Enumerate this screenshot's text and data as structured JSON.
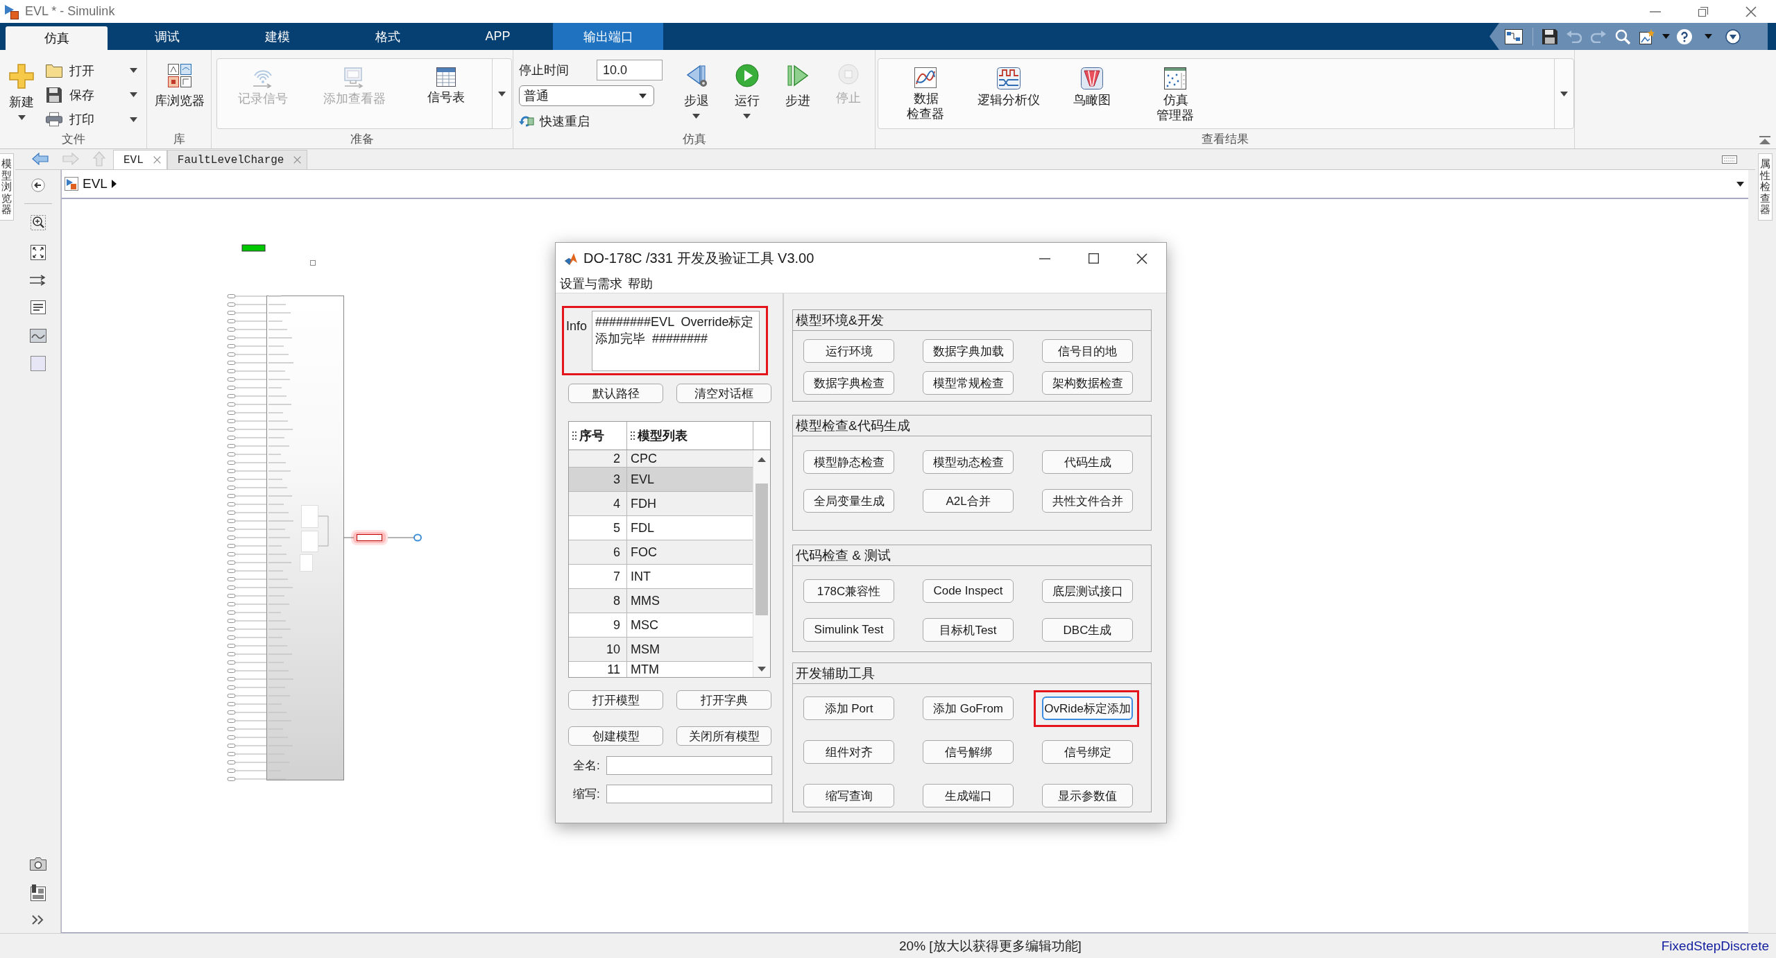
{
  "window": {
    "title": "EVL * - Simulink"
  },
  "ribbon_tabs": [
    {
      "label": "仿真",
      "kind": "standard",
      "selected": true
    },
    {
      "label": "调试",
      "kind": "standard",
      "selected": false
    },
    {
      "label": "建模",
      "kind": "standard",
      "selected": false
    },
    {
      "label": "格式",
      "kind": "standard",
      "selected": false
    },
    {
      "label": "APP",
      "kind": "standard",
      "selected": false
    },
    {
      "label": "输出端口",
      "kind": "contextual",
      "selected": false
    }
  ],
  "ribbon": {
    "file": {
      "label": "文件",
      "items": [
        {
          "label": "新建"
        },
        {
          "label": "打开"
        },
        {
          "label": "保存"
        },
        {
          "label": "打印"
        }
      ]
    },
    "library": {
      "label": "库",
      "items": [
        {
          "label": "库浏览器"
        }
      ]
    },
    "prepare": {
      "label": "准备",
      "items": [
        {
          "label": "记录信号",
          "disabled": true
        },
        {
          "label": "添加查看器",
          "disabled": true
        },
        {
          "label": "信号表",
          "disabled": false
        }
      ]
    },
    "simulation": {
      "label": "仿真",
      "stop_time": {
        "label": "停止时间",
        "value": "10.0"
      },
      "mode": {
        "value": "普通"
      },
      "fast_restart": {
        "label": "快速重启"
      },
      "items": [
        {
          "label": "步退",
          "disabled": false
        },
        {
          "label": "运行",
          "disabled": false
        },
        {
          "label": "步进",
          "disabled": false
        },
        {
          "label": "停止",
          "disabled": true
        }
      ]
    },
    "review": {
      "label": "查看结果",
      "items": [
        {
          "label": "数据检查器"
        },
        {
          "label": "逻辑分析仪"
        },
        {
          "label": "鸟瞰图"
        },
        {
          "label": "仿真管理器"
        }
      ]
    }
  },
  "side_panels": {
    "left": "模型浏览器",
    "right": "属性检查器"
  },
  "doc_tabs": [
    {
      "label": "EVL",
      "selected": true
    },
    {
      "label": "FaultLevelCharge",
      "selected": false
    }
  ],
  "breadcrumb": [
    "EVL"
  ],
  "dialog": {
    "title": "DO-178C /331 开发及验证工具 V3.00",
    "menu": [
      "设置与需求",
      "帮助"
    ],
    "info": {
      "label": "Info",
      "text": "########EVL  Override标定添加完毕  ########",
      "highlighted": true
    },
    "path_buttons": [
      "默认路径",
      "清空对话框"
    ],
    "model_table": {
      "columns": [
        "序号",
        "模型列表"
      ],
      "rows": [
        {
          "index": "2",
          "name": "CPC",
          "selected": false
        },
        {
          "index": "3",
          "name": "EVL",
          "selected": true
        },
        {
          "index": "4",
          "name": "FDH",
          "selected": false
        },
        {
          "index": "5",
          "name": "FDL",
          "selected": false
        },
        {
          "index": "6",
          "name": "FOC",
          "selected": false
        },
        {
          "index": "7",
          "name": "INT",
          "selected": false
        },
        {
          "index": "8",
          "name": "MMS",
          "selected": false
        },
        {
          "index": "9",
          "name": "MSC",
          "selected": false
        },
        {
          "index": "10",
          "name": "MSM",
          "selected": false
        },
        {
          "index": "11",
          "name": "MTM",
          "selected": false
        }
      ]
    },
    "model_buttons": [
      "打开模型",
      "打开字典",
      "创建模型",
      "关闭所有模型"
    ],
    "fields": [
      {
        "label": "全名:"
      },
      {
        "label": "缩写:"
      }
    ],
    "groups": [
      {
        "title": "模型环境&开发",
        "buttons": [
          {
            "label": "运行环境",
            "focused": false,
            "highlighted": false
          },
          {
            "label": "数据字典加载",
            "focused": false,
            "highlighted": false
          },
          {
            "label": "信号目的地",
            "focused": false,
            "highlighted": false
          },
          {
            "label": "数据字典检查",
            "focused": false,
            "highlighted": false
          },
          {
            "label": "模型常规检查",
            "focused": false,
            "highlighted": false
          },
          {
            "label": "架构数据检查",
            "focused": false,
            "highlighted": false
          }
        ]
      },
      {
        "title": "模型检查&代码生成",
        "buttons": [
          {
            "label": "模型静态检查",
            "focused": false,
            "highlighted": false
          },
          {
            "label": "模型动态检查",
            "focused": false,
            "highlighted": false
          },
          {
            "label": "代码生成",
            "focused": false,
            "highlighted": false
          },
          {
            "label": "全局变量生成",
            "focused": false,
            "highlighted": false
          },
          {
            "label": "A2L合并",
            "focused": false,
            "highlighted": false
          },
          {
            "label": "共性文件合并",
            "focused": false,
            "highlighted": false
          }
        ]
      },
      {
        "title": "代码检查 & 测试",
        "buttons": [
          {
            "label": "178C兼容性",
            "focused": false,
            "highlighted": false
          },
          {
            "label": "Code Inspect",
            "focused": false,
            "highlighted": false
          },
          {
            "label": "底层测试接口",
            "focused": false,
            "highlighted": false
          },
          {
            "label": "Simulink Test",
            "focused": false,
            "highlighted": false
          },
          {
            "label": "目标机Test",
            "focused": false,
            "highlighted": false
          },
          {
            "label": "DBC生成",
            "focused": false,
            "highlighted": false
          }
        ]
      },
      {
        "title": "开发辅助工具",
        "buttons": [
          {
            "label": "添加 Port",
            "focused": false,
            "highlighted": false
          },
          {
            "label": "添加 GoFrom",
            "focused": false,
            "highlighted": false
          },
          {
            "label": "OvRide标定添加",
            "focused": true,
            "highlighted": true
          },
          {
            "label": "组件对齐",
            "focused": false,
            "highlighted": false
          },
          {
            "label": "信号解绑",
            "focused": false,
            "highlighted": false
          },
          {
            "label": "信号绑定",
            "focused": false,
            "highlighted": false
          },
          {
            "label": "缩写查询",
            "focused": false,
            "highlighted": false
          },
          {
            "label": "生成端口",
            "focused": false,
            "highlighted": false
          },
          {
            "label": "显示参数值",
            "focused": false,
            "highlighted": false
          }
        ]
      }
    ]
  },
  "status_bar": {
    "zoom": "20% [放大以获得更多编辑功能]",
    "solver": "FixedStepDiscrete"
  }
}
